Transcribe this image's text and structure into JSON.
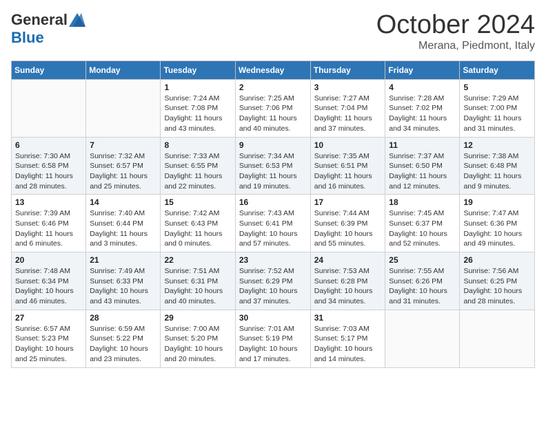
{
  "header": {
    "logo_general": "General",
    "logo_blue": "Blue",
    "month_title": "October 2024",
    "location": "Merana, Piedmont, Italy"
  },
  "calendar": {
    "days_of_week": [
      "Sunday",
      "Monday",
      "Tuesday",
      "Wednesday",
      "Thursday",
      "Friday",
      "Saturday"
    ],
    "weeks": [
      [
        {
          "day": "",
          "info": ""
        },
        {
          "day": "",
          "info": ""
        },
        {
          "day": "1",
          "info": "Sunrise: 7:24 AM\nSunset: 7:08 PM\nDaylight: 11 hours and 43 minutes."
        },
        {
          "day": "2",
          "info": "Sunrise: 7:25 AM\nSunset: 7:06 PM\nDaylight: 11 hours and 40 minutes."
        },
        {
          "day": "3",
          "info": "Sunrise: 7:27 AM\nSunset: 7:04 PM\nDaylight: 11 hours and 37 minutes."
        },
        {
          "day": "4",
          "info": "Sunrise: 7:28 AM\nSunset: 7:02 PM\nDaylight: 11 hours and 34 minutes."
        },
        {
          "day": "5",
          "info": "Sunrise: 7:29 AM\nSunset: 7:00 PM\nDaylight: 11 hours and 31 minutes."
        }
      ],
      [
        {
          "day": "6",
          "info": "Sunrise: 7:30 AM\nSunset: 6:58 PM\nDaylight: 11 hours and 28 minutes."
        },
        {
          "day": "7",
          "info": "Sunrise: 7:32 AM\nSunset: 6:57 PM\nDaylight: 11 hours and 25 minutes."
        },
        {
          "day": "8",
          "info": "Sunrise: 7:33 AM\nSunset: 6:55 PM\nDaylight: 11 hours and 22 minutes."
        },
        {
          "day": "9",
          "info": "Sunrise: 7:34 AM\nSunset: 6:53 PM\nDaylight: 11 hours and 19 minutes."
        },
        {
          "day": "10",
          "info": "Sunrise: 7:35 AM\nSunset: 6:51 PM\nDaylight: 11 hours and 16 minutes."
        },
        {
          "day": "11",
          "info": "Sunrise: 7:37 AM\nSunset: 6:50 PM\nDaylight: 11 hours and 12 minutes."
        },
        {
          "day": "12",
          "info": "Sunrise: 7:38 AM\nSunset: 6:48 PM\nDaylight: 11 hours and 9 minutes."
        }
      ],
      [
        {
          "day": "13",
          "info": "Sunrise: 7:39 AM\nSunset: 6:46 PM\nDaylight: 11 hours and 6 minutes."
        },
        {
          "day": "14",
          "info": "Sunrise: 7:40 AM\nSunset: 6:44 PM\nDaylight: 11 hours and 3 minutes."
        },
        {
          "day": "15",
          "info": "Sunrise: 7:42 AM\nSunset: 6:43 PM\nDaylight: 11 hours and 0 minutes."
        },
        {
          "day": "16",
          "info": "Sunrise: 7:43 AM\nSunset: 6:41 PM\nDaylight: 10 hours and 57 minutes."
        },
        {
          "day": "17",
          "info": "Sunrise: 7:44 AM\nSunset: 6:39 PM\nDaylight: 10 hours and 55 minutes."
        },
        {
          "day": "18",
          "info": "Sunrise: 7:45 AM\nSunset: 6:37 PM\nDaylight: 10 hours and 52 minutes."
        },
        {
          "day": "19",
          "info": "Sunrise: 7:47 AM\nSunset: 6:36 PM\nDaylight: 10 hours and 49 minutes."
        }
      ],
      [
        {
          "day": "20",
          "info": "Sunrise: 7:48 AM\nSunset: 6:34 PM\nDaylight: 10 hours and 46 minutes."
        },
        {
          "day": "21",
          "info": "Sunrise: 7:49 AM\nSunset: 6:33 PM\nDaylight: 10 hours and 43 minutes."
        },
        {
          "day": "22",
          "info": "Sunrise: 7:51 AM\nSunset: 6:31 PM\nDaylight: 10 hours and 40 minutes."
        },
        {
          "day": "23",
          "info": "Sunrise: 7:52 AM\nSunset: 6:29 PM\nDaylight: 10 hours and 37 minutes."
        },
        {
          "day": "24",
          "info": "Sunrise: 7:53 AM\nSunset: 6:28 PM\nDaylight: 10 hours and 34 minutes."
        },
        {
          "day": "25",
          "info": "Sunrise: 7:55 AM\nSunset: 6:26 PM\nDaylight: 10 hours and 31 minutes."
        },
        {
          "day": "26",
          "info": "Sunrise: 7:56 AM\nSunset: 6:25 PM\nDaylight: 10 hours and 28 minutes."
        }
      ],
      [
        {
          "day": "27",
          "info": "Sunrise: 6:57 AM\nSunset: 5:23 PM\nDaylight: 10 hours and 25 minutes."
        },
        {
          "day": "28",
          "info": "Sunrise: 6:59 AM\nSunset: 5:22 PM\nDaylight: 10 hours and 23 minutes."
        },
        {
          "day": "29",
          "info": "Sunrise: 7:00 AM\nSunset: 5:20 PM\nDaylight: 10 hours and 20 minutes."
        },
        {
          "day": "30",
          "info": "Sunrise: 7:01 AM\nSunset: 5:19 PM\nDaylight: 10 hours and 17 minutes."
        },
        {
          "day": "31",
          "info": "Sunrise: 7:03 AM\nSunset: 5:17 PM\nDaylight: 10 hours and 14 minutes."
        },
        {
          "day": "",
          "info": ""
        },
        {
          "day": "",
          "info": ""
        }
      ]
    ]
  }
}
